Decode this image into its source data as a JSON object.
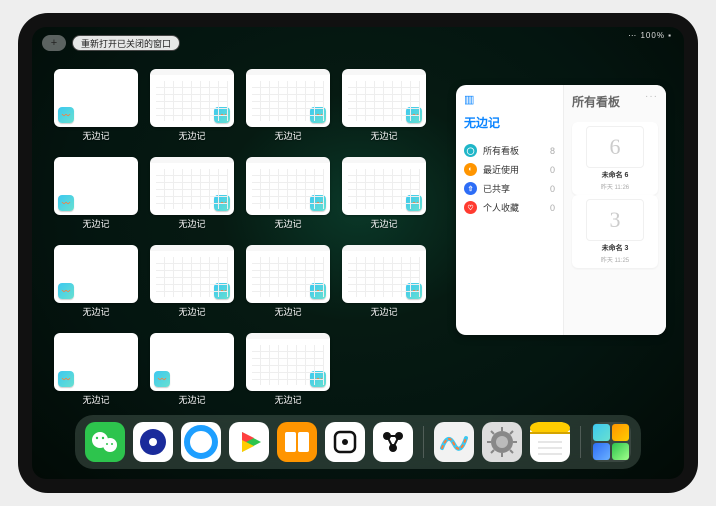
{
  "status": {
    "right": "⋯ 100% ▪"
  },
  "top": {
    "plus": "+",
    "reopen_label": "重新打开已关闭的窗口"
  },
  "app_name": "无边记",
  "cards": [
    "a",
    "b",
    "b",
    "b",
    "a",
    "b",
    "b",
    "b",
    "a",
    "b",
    "b",
    "b",
    "a",
    "a",
    "b"
  ],
  "sidebar": {
    "title_left": "无边记",
    "title_right": "所有看板",
    "more": "···",
    "items": [
      {
        "icon": "teal",
        "glyph": "◯",
        "label": "所有看板",
        "count": 8
      },
      {
        "icon": "orange",
        "glyph": "◐",
        "label": "最近使用",
        "count": 0
      },
      {
        "icon": "blue",
        "glyph": "⇧",
        "label": "已共享",
        "count": 0
      },
      {
        "icon": "red",
        "glyph": "♡",
        "label": "个人收藏",
        "count": 0
      }
    ],
    "boards": [
      {
        "sketch": "6",
        "name": "未命名 6",
        "date": "昨天 11:26"
      },
      {
        "sketch": "3",
        "name": "未命名 3",
        "date": "昨天 11:25"
      }
    ]
  },
  "dock": {
    "icons": [
      "wechat",
      "circle-dark",
      "qq-browser",
      "play",
      "books",
      "dice",
      "connect",
      "freeform",
      "settings",
      "notes"
    ]
  }
}
